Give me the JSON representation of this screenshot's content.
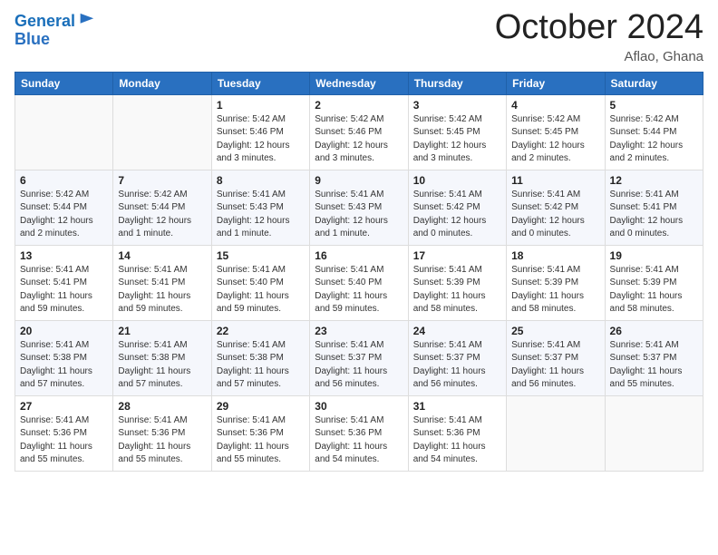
{
  "header": {
    "logo_line1": "General",
    "logo_line2": "Blue",
    "month_title": "October 2024",
    "location": "Aflao, Ghana"
  },
  "days_of_week": [
    "Sunday",
    "Monday",
    "Tuesday",
    "Wednesday",
    "Thursday",
    "Friday",
    "Saturday"
  ],
  "weeks": [
    [
      {
        "day": "",
        "info": ""
      },
      {
        "day": "",
        "info": ""
      },
      {
        "day": "1",
        "info": "Sunrise: 5:42 AM\nSunset: 5:46 PM\nDaylight: 12 hours and 3 minutes."
      },
      {
        "day": "2",
        "info": "Sunrise: 5:42 AM\nSunset: 5:46 PM\nDaylight: 12 hours and 3 minutes."
      },
      {
        "day": "3",
        "info": "Sunrise: 5:42 AM\nSunset: 5:45 PM\nDaylight: 12 hours and 3 minutes."
      },
      {
        "day": "4",
        "info": "Sunrise: 5:42 AM\nSunset: 5:45 PM\nDaylight: 12 hours and 2 minutes."
      },
      {
        "day": "5",
        "info": "Sunrise: 5:42 AM\nSunset: 5:44 PM\nDaylight: 12 hours and 2 minutes."
      }
    ],
    [
      {
        "day": "6",
        "info": "Sunrise: 5:42 AM\nSunset: 5:44 PM\nDaylight: 12 hours and 2 minutes."
      },
      {
        "day": "7",
        "info": "Sunrise: 5:42 AM\nSunset: 5:44 PM\nDaylight: 12 hours and 1 minute."
      },
      {
        "day": "8",
        "info": "Sunrise: 5:41 AM\nSunset: 5:43 PM\nDaylight: 12 hours and 1 minute."
      },
      {
        "day": "9",
        "info": "Sunrise: 5:41 AM\nSunset: 5:43 PM\nDaylight: 12 hours and 1 minute."
      },
      {
        "day": "10",
        "info": "Sunrise: 5:41 AM\nSunset: 5:42 PM\nDaylight: 12 hours and 0 minutes."
      },
      {
        "day": "11",
        "info": "Sunrise: 5:41 AM\nSunset: 5:42 PM\nDaylight: 12 hours and 0 minutes."
      },
      {
        "day": "12",
        "info": "Sunrise: 5:41 AM\nSunset: 5:41 PM\nDaylight: 12 hours and 0 minutes."
      }
    ],
    [
      {
        "day": "13",
        "info": "Sunrise: 5:41 AM\nSunset: 5:41 PM\nDaylight: 11 hours and 59 minutes."
      },
      {
        "day": "14",
        "info": "Sunrise: 5:41 AM\nSunset: 5:41 PM\nDaylight: 11 hours and 59 minutes."
      },
      {
        "day": "15",
        "info": "Sunrise: 5:41 AM\nSunset: 5:40 PM\nDaylight: 11 hours and 59 minutes."
      },
      {
        "day": "16",
        "info": "Sunrise: 5:41 AM\nSunset: 5:40 PM\nDaylight: 11 hours and 59 minutes."
      },
      {
        "day": "17",
        "info": "Sunrise: 5:41 AM\nSunset: 5:39 PM\nDaylight: 11 hours and 58 minutes."
      },
      {
        "day": "18",
        "info": "Sunrise: 5:41 AM\nSunset: 5:39 PM\nDaylight: 11 hours and 58 minutes."
      },
      {
        "day": "19",
        "info": "Sunrise: 5:41 AM\nSunset: 5:39 PM\nDaylight: 11 hours and 58 minutes."
      }
    ],
    [
      {
        "day": "20",
        "info": "Sunrise: 5:41 AM\nSunset: 5:38 PM\nDaylight: 11 hours and 57 minutes."
      },
      {
        "day": "21",
        "info": "Sunrise: 5:41 AM\nSunset: 5:38 PM\nDaylight: 11 hours and 57 minutes."
      },
      {
        "day": "22",
        "info": "Sunrise: 5:41 AM\nSunset: 5:38 PM\nDaylight: 11 hours and 57 minutes."
      },
      {
        "day": "23",
        "info": "Sunrise: 5:41 AM\nSunset: 5:37 PM\nDaylight: 11 hours and 56 minutes."
      },
      {
        "day": "24",
        "info": "Sunrise: 5:41 AM\nSunset: 5:37 PM\nDaylight: 11 hours and 56 minutes."
      },
      {
        "day": "25",
        "info": "Sunrise: 5:41 AM\nSunset: 5:37 PM\nDaylight: 11 hours and 56 minutes."
      },
      {
        "day": "26",
        "info": "Sunrise: 5:41 AM\nSunset: 5:37 PM\nDaylight: 11 hours and 55 minutes."
      }
    ],
    [
      {
        "day": "27",
        "info": "Sunrise: 5:41 AM\nSunset: 5:36 PM\nDaylight: 11 hours and 55 minutes."
      },
      {
        "day": "28",
        "info": "Sunrise: 5:41 AM\nSunset: 5:36 PM\nDaylight: 11 hours and 55 minutes."
      },
      {
        "day": "29",
        "info": "Sunrise: 5:41 AM\nSunset: 5:36 PM\nDaylight: 11 hours and 55 minutes."
      },
      {
        "day": "30",
        "info": "Sunrise: 5:41 AM\nSunset: 5:36 PM\nDaylight: 11 hours and 54 minutes."
      },
      {
        "day": "31",
        "info": "Sunrise: 5:41 AM\nSunset: 5:36 PM\nDaylight: 11 hours and 54 minutes."
      },
      {
        "day": "",
        "info": ""
      },
      {
        "day": "",
        "info": ""
      }
    ]
  ]
}
